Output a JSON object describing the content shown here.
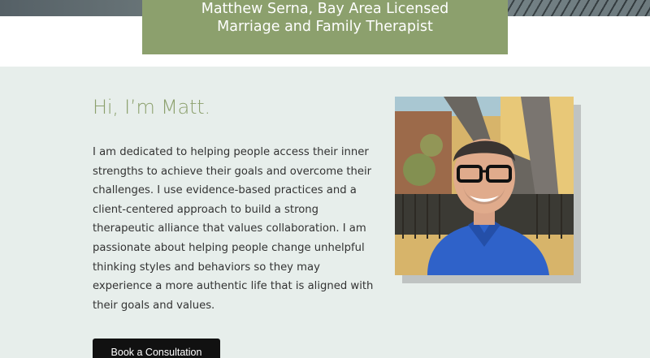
{
  "hero": {
    "title_line1": "Matthew Serna, Bay Area Licensed",
    "title_line2": "Marriage and Family Therapist"
  },
  "about": {
    "greeting": "Hi, I’m Matt.",
    "bio": "I am dedicated to helping people access their inner strengths to achieve their goals and overcome their challenges. I use evidence-based practices and a client-centered approach to build a strong therapeutic alliance that values collaboration. I am passionate about helping people change unhelpful thinking styles and behaviors so they may experience a more authentic life that is aligned with their goals and values."
  },
  "cta": {
    "label": "Book a Consultation"
  },
  "colors": {
    "accent": "#8ca06d",
    "section_bg": "#e7eeeb",
    "button_bg": "#111111"
  }
}
